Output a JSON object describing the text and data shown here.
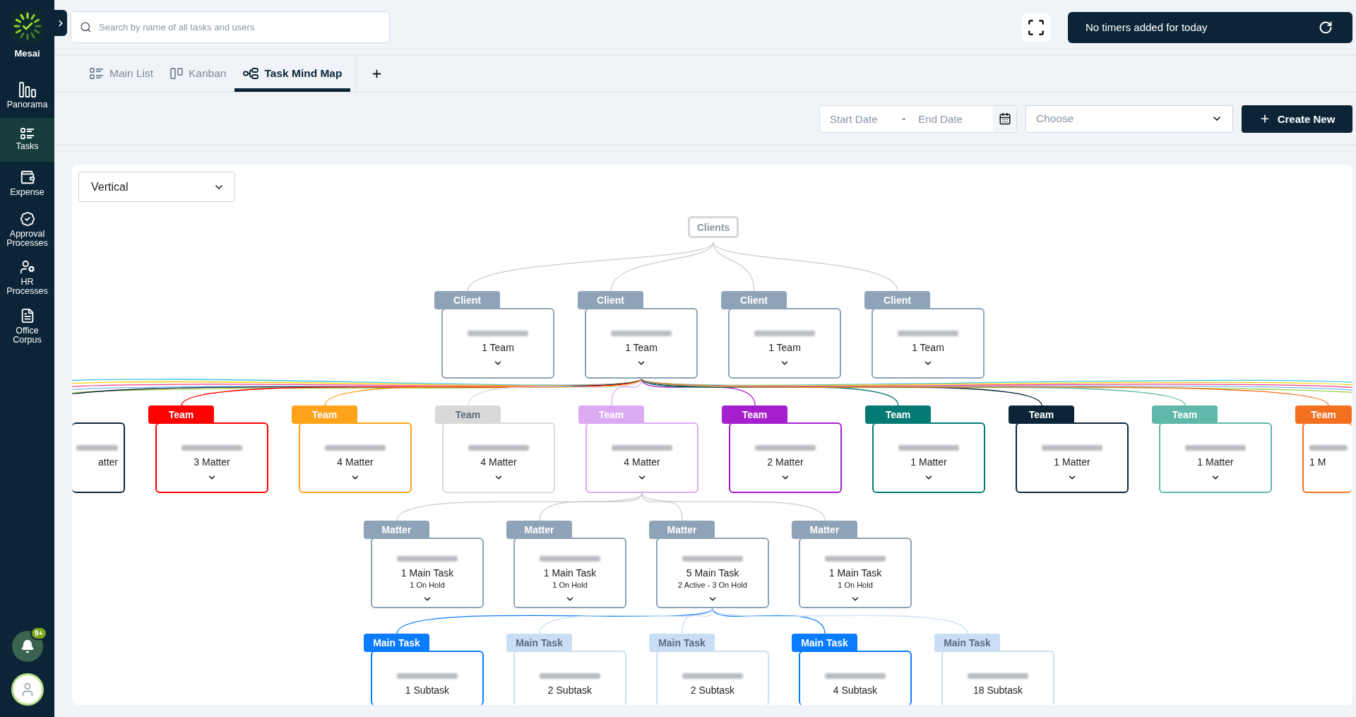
{
  "sidebar": {
    "brand": "Mesai",
    "items": [
      {
        "label": "Panorama",
        "selected": false
      },
      {
        "label": "Tasks",
        "selected": true
      },
      {
        "label": "Expense",
        "selected": false
      },
      {
        "label": "Approval Processes",
        "selected": false
      },
      {
        "label": "HR Processes",
        "selected": false
      },
      {
        "label": "Office Corpus",
        "selected": false
      }
    ],
    "notification_badge": "9+"
  },
  "search": {
    "placeholder": "Search by name of all tasks and users"
  },
  "timer": {
    "text": "No timers added for today"
  },
  "tabs": [
    {
      "label": "Main List",
      "selected": false
    },
    {
      "label": "Kanban",
      "selected": false
    },
    {
      "label": "Task Mind Map",
      "selected": true
    }
  ],
  "filters": {
    "start_placeholder": "Start Date",
    "separator": "-",
    "end_placeholder": "End Date",
    "select_placeholder": "Choose",
    "create_button": "Create New"
  },
  "layout_select": {
    "value": "Vertical"
  },
  "mind_map": {
    "root": "Clients",
    "clients": [
      {
        "tag": "Client",
        "count": "1 Team"
      },
      {
        "tag": "Client",
        "count": "1 Team",
        "children": [
          {
            "count": "atter",
            "color": "#0b2537"
          },
          {
            "tag": "Team",
            "count": "3 Matter",
            "color": "#ff0000"
          },
          {
            "tag": "Team",
            "count": "4 Matter",
            "color": "#ffa31a"
          },
          {
            "tag": "Team",
            "count": "4 Matter",
            "color": "#d9d9d9"
          },
          {
            "tag": "Team",
            "count": "4 Matter",
            "color": "#dcaaf2",
            "children": [
              {
                "tag": "Matter",
                "count": "1 Main Task",
                "status": "1 On Hold"
              },
              {
                "tag": "Matter",
                "count": "1 Main Task",
                "status": "1 On Hold"
              },
              {
                "tag": "Matter",
                "count": "5 Main Task",
                "status": "2 Active - 3 On Hold",
                "children": [
                  {
                    "tag": "Main Task",
                    "count": "1 Subtask",
                    "active": true
                  },
                  {
                    "tag": "Main Task",
                    "count": "2 Subtask",
                    "active": false
                  },
                  {
                    "tag": "Main Task",
                    "count": "2 Subtask",
                    "active": false
                  },
                  {
                    "tag": "Main Task",
                    "count": "4 Subtask",
                    "active": true
                  },
                  {
                    "tag": "Main Task",
                    "count": "18 Subtask",
                    "active": false
                  }
                ]
              },
              {
                "tag": "Matter",
                "count": "1 Main Task",
                "status": "1 On Hold"
              }
            ]
          },
          {
            "tag": "Team",
            "count": "2 Matter",
            "color": "#a51fcf"
          },
          {
            "tag": "Team",
            "count": "1 Matter",
            "color": "#047a74"
          },
          {
            "tag": "Team",
            "count": "1 Matter",
            "color": "#0b2537"
          },
          {
            "tag": "Team",
            "count": "1 Matter",
            "color": "#5fb8a9"
          },
          {
            "tag": "Team",
            "count": "1 M",
            "color": "#f37021"
          }
        ]
      },
      {
        "tag": "Client",
        "count": "1 Team"
      },
      {
        "tag": "Client",
        "count": "1 Team"
      }
    ]
  }
}
